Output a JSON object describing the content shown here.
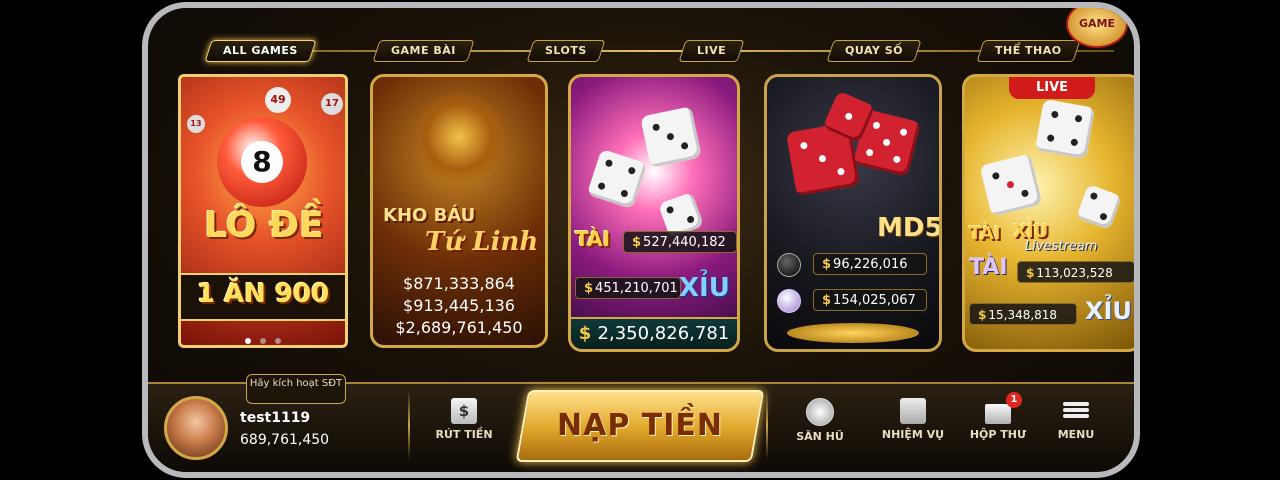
{
  "tabs": [
    {
      "label": "ALL GAMES",
      "active": true
    },
    {
      "label": "GAME BÀI",
      "active": false
    },
    {
      "label": "SLOTS",
      "active": false
    },
    {
      "label": "LIVE",
      "active": false
    },
    {
      "label": "QUAY SỐ",
      "active": false
    },
    {
      "label": "THỂ THAO",
      "active": false
    }
  ],
  "corner_badge": "GAME",
  "cards": {
    "lode": {
      "title": "LÔ ĐỀ",
      "ball_number": "8",
      "small_balls": [
        "49",
        "17",
        "13"
      ],
      "tagline": "1 ĂN 900",
      "pager_count": 3,
      "pager_active": 0
    },
    "khobau": {
      "title_line1": "KHO BÁU",
      "title_line2": "Tứ Linh",
      "jackpots": [
        "$871,333,864",
        "$913,445,136",
        "$2,689,761,450"
      ]
    },
    "taixiu": {
      "label_tai": "TÀI",
      "label_xiu": "XỈU",
      "amount_tai": "527,440,182",
      "amount_xiu": "451,210,701",
      "jackpot": "2,350,826,781"
    },
    "md5": {
      "label": "MD5",
      "amount1": "96,226,016",
      "amount2": "154,025,067"
    },
    "livestream": {
      "badge": "LIVE",
      "title_tai": "TÀI",
      "title_xiu": "XỈU",
      "subtitle": "Livestream",
      "label_tai": "TÀI",
      "label_xiu": "XỈU",
      "amount_tai": "113,023,528",
      "amount_xiu": "15,348,818"
    }
  },
  "user": {
    "activate_text": "Hãy kích hoạt SĐT",
    "username": "test1119",
    "balance": "689,761,450"
  },
  "bottom_nav": {
    "withdraw": "RÚT TIỀN",
    "deposit": "NẠP TIỀN",
    "jackpot_hunt": "SĂN HŨ",
    "missions": "NHIỆM VỤ",
    "mailbox": "HỘP THƯ",
    "mail_count": "1",
    "menu": "MENU"
  },
  "colors": {
    "gold": "#d4a845",
    "deposit_bg": "#e0a628",
    "live_red": "#d11a1a"
  }
}
